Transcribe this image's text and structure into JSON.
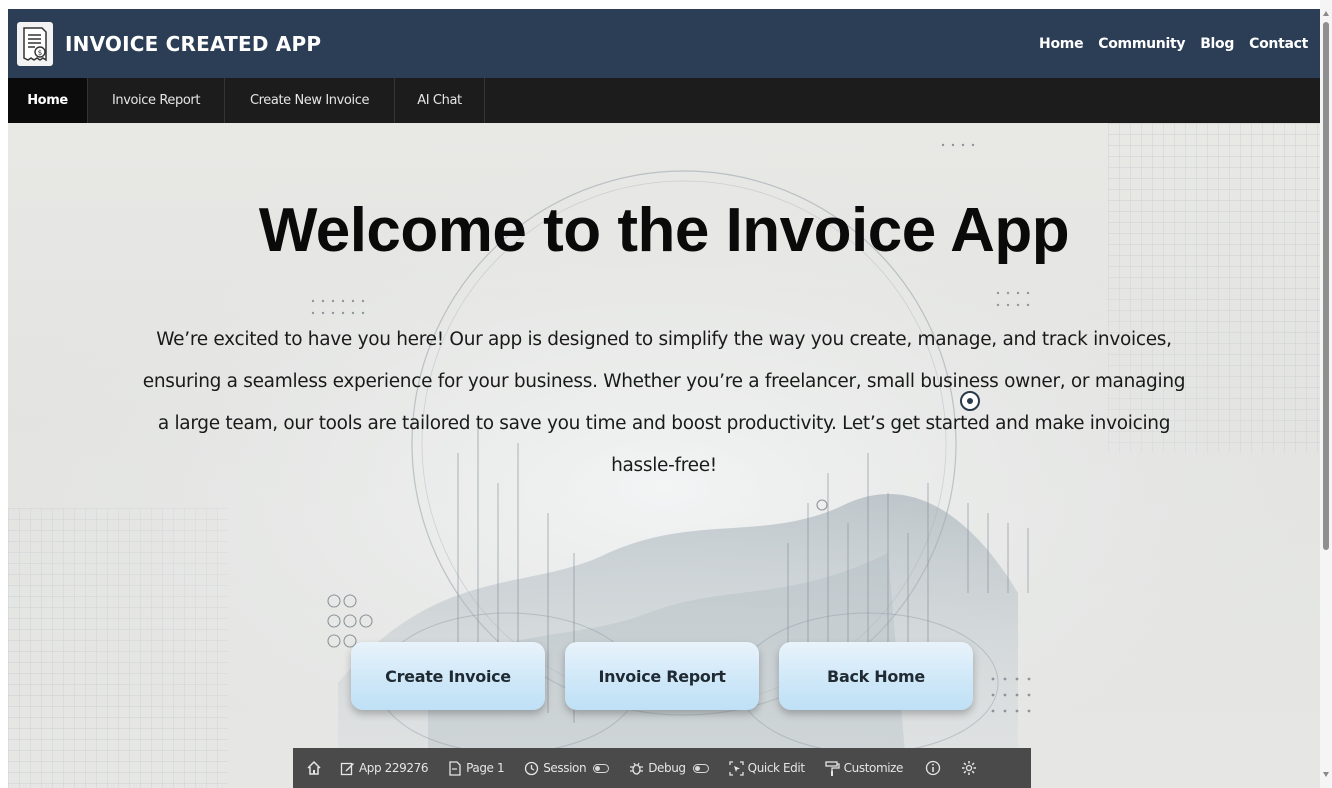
{
  "app": {
    "title": "INVOICE CREATED APP"
  },
  "top_nav": [
    {
      "label": "Home"
    },
    {
      "label": "Community"
    },
    {
      "label": "Blog"
    },
    {
      "label": "Contact"
    }
  ],
  "tabs": [
    {
      "label": "Home",
      "active": true
    },
    {
      "label": "Invoice Report",
      "active": false
    },
    {
      "label": "Create New Invoice",
      "active": false
    },
    {
      "label": "AI Chat",
      "active": false
    }
  ],
  "hero": {
    "title": "Welcome to the Invoice App",
    "text": "We’re excited to have you here! Our app is designed to simplify the way you create, manage, and track invoices, ensuring a seamless experience for your business. Whether you’re a freelancer, small business owner, or managing a large team, our tools are tailored to save you time and boost productivity. Let’s get started and make invoicing hassle-free!",
    "buttons": [
      {
        "label": "Create Invoice"
      },
      {
        "label": "Invoice Report"
      },
      {
        "label": "Back Home"
      }
    ]
  },
  "dev_toolbar": {
    "app": "App 229276",
    "page": "Page 1",
    "session": "Session",
    "debug": "Debug",
    "quick_edit": "Quick Edit",
    "customize": "Customize"
  },
  "colors": {
    "header_bg": "#2c3e55",
    "tab_bar_bg": "#1c1c1c",
    "button_bg": "#cde7f8",
    "dev_toolbar_bg": "#4a4a4a"
  },
  "icons": {
    "logo": "invoice-receipt-icon",
    "dev_toolbar": [
      "home-icon",
      "edit-icon",
      "page-icon",
      "clock-icon",
      "bug-icon",
      "quick-edit-icon",
      "paint-roller-icon",
      "info-icon",
      "gear-icon"
    ]
  }
}
